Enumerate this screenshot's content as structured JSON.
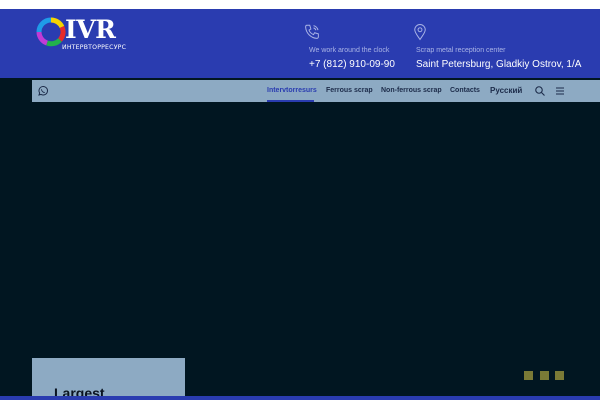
{
  "colors": {
    "header_bg": "#2a3cb0",
    "hero_bg": "#011621",
    "nav_bg": "#8daac3",
    "accent": "#2a3cb0",
    "slider_dot": "#7a7a36"
  },
  "header": {
    "logo": {
      "title": "IVR",
      "subtitle": "ИНТЕРВТОРРЕСУРС"
    },
    "phone": {
      "icon": "phone-icon",
      "caption": "We work around the clock",
      "value": "+7 (812) 910-09-90"
    },
    "address": {
      "icon": "map-pin-icon",
      "caption": "Scrap metal reception center",
      "value": "Saint Petersburg, Gladkiy Ostrov, 1/A"
    }
  },
  "nav": {
    "whatsapp_icon": "whatsapp-icon",
    "items": [
      {
        "label": "Intervtorresurs",
        "active": true
      },
      {
        "label": "Ferrous scrap",
        "active": false
      },
      {
        "label": "Non-ferrous scrap",
        "active": false
      },
      {
        "label": "Contacts",
        "active": false
      }
    ],
    "language": "Русский",
    "search_icon": "search-icon",
    "menu_icon": "hamburger-menu-icon"
  },
  "hero": {
    "slide_title": "Largest",
    "slider_dots": 3
  }
}
